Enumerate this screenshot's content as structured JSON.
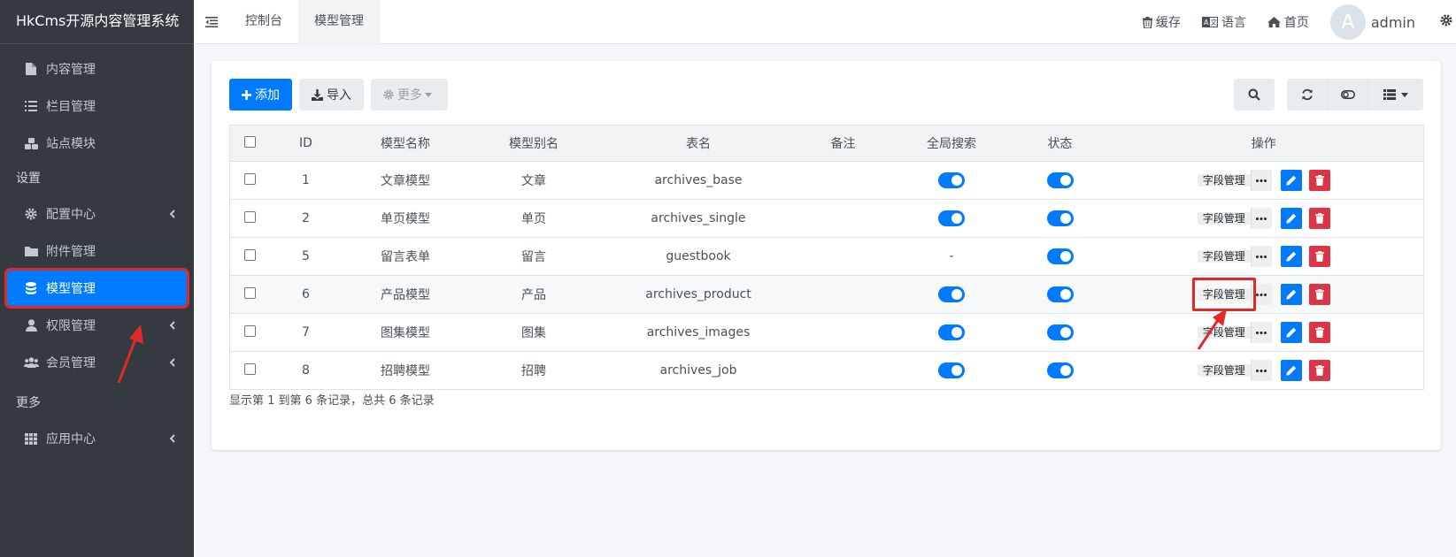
{
  "app": {
    "title": "HkCms开源内容管理系统"
  },
  "sidebar": {
    "items_top": [
      {
        "label": "内容管理",
        "icon": "file-icon"
      },
      {
        "label": "栏目管理",
        "icon": "list-icon"
      },
      {
        "label": "站点模块",
        "icon": "cubes-icon"
      }
    ],
    "section_settings": "设置",
    "items_settings": [
      {
        "label": "配置中心",
        "icon": "gear-icon",
        "has_children": true
      },
      {
        "label": "附件管理",
        "icon": "folder-icon",
        "has_children": false
      },
      {
        "label": "模型管理",
        "icon": "database-icon",
        "has_children": false,
        "active": true
      },
      {
        "label": "权限管理",
        "icon": "user-icon",
        "has_children": true
      },
      {
        "label": "会员管理",
        "icon": "users-icon",
        "has_children": true
      }
    ],
    "section_more": "更多",
    "items_more": [
      {
        "label": "应用中心",
        "icon": "grid-icon",
        "has_children": true
      }
    ]
  },
  "topbar": {
    "tabs": [
      {
        "label": "控制台",
        "active": false
      },
      {
        "label": "模型管理",
        "active": true
      }
    ],
    "cache_label": "缓存",
    "language_label": "语言",
    "home_label": "首页",
    "avatar_letter": "A",
    "user_name": "admin"
  },
  "toolbar": {
    "add_label": "添加",
    "import_label": "导入",
    "more_label": "更多"
  },
  "table": {
    "headers": [
      "ID",
      "模型名称",
      "模型别名",
      "表名",
      "备注",
      "全局搜索",
      "状态",
      "操作"
    ],
    "field_manage_label": "字段管理",
    "rows": [
      {
        "id": "1",
        "name": "文章模型",
        "alias": "文章",
        "table": "archives_base",
        "remark": "",
        "search": "on",
        "status": "on"
      },
      {
        "id": "2",
        "name": "单页模型",
        "alias": "单页",
        "table": "archives_single",
        "remark": "",
        "search": "on",
        "status": "on"
      },
      {
        "id": "5",
        "name": "留言表单",
        "alias": "留言",
        "table": "guestbook",
        "remark": "",
        "search": "-",
        "status": "on"
      },
      {
        "id": "6",
        "name": "产品模型",
        "alias": "产品",
        "table": "archives_product",
        "remark": "",
        "search": "on",
        "status": "on"
      },
      {
        "id": "7",
        "name": "图集模型",
        "alias": "图集",
        "table": "archives_images",
        "remark": "",
        "search": "on",
        "status": "on"
      },
      {
        "id": "8",
        "name": "招聘模型",
        "alias": "招聘",
        "table": "archives_job",
        "remark": "",
        "search": "on",
        "status": "on"
      }
    ]
  },
  "summary": "显示第 1 到第 6 条记录，总共 6 条记录",
  "colors": {
    "sidebar_bg": "#343a40",
    "primary": "#007bff",
    "danger": "#dc3545",
    "annotation": "#e02a2a"
  }
}
